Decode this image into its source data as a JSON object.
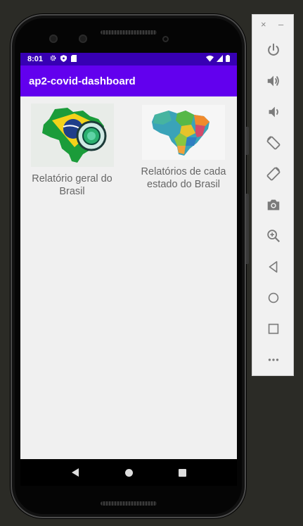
{
  "status_bar": {
    "time": "8:01",
    "icons": [
      "gear-icon",
      "shield-icon",
      "sim-card-icon"
    ],
    "right_icons": [
      "wifi-icon",
      "cellular-signal-icon",
      "battery-icon"
    ]
  },
  "app_bar": {
    "title": "ap2-covid-dashboard"
  },
  "items": [
    {
      "label": "Relatório geral do Brasil",
      "image": "brazil-flag-map-with-virus"
    },
    {
      "label": "Relatórios de cada estado do Brasil",
      "image": "brazil-states-colored-map"
    }
  ],
  "nav": {
    "back": "back-icon",
    "home": "home-icon",
    "recents": "recents-icon"
  },
  "emulator_toolbar": {
    "close": "×",
    "minimize": "–",
    "buttons": [
      "power-icon",
      "volume-up-icon",
      "volume-down-icon",
      "rotate-left-icon",
      "rotate-right-icon",
      "camera-icon",
      "zoom-icon",
      "back-icon",
      "home-icon",
      "overview-icon",
      "more-icon"
    ]
  },
  "colors": {
    "primary": "#6200ee",
    "primary_dark": "#3700b3",
    "screen_bg": "#f0f0f0"
  }
}
